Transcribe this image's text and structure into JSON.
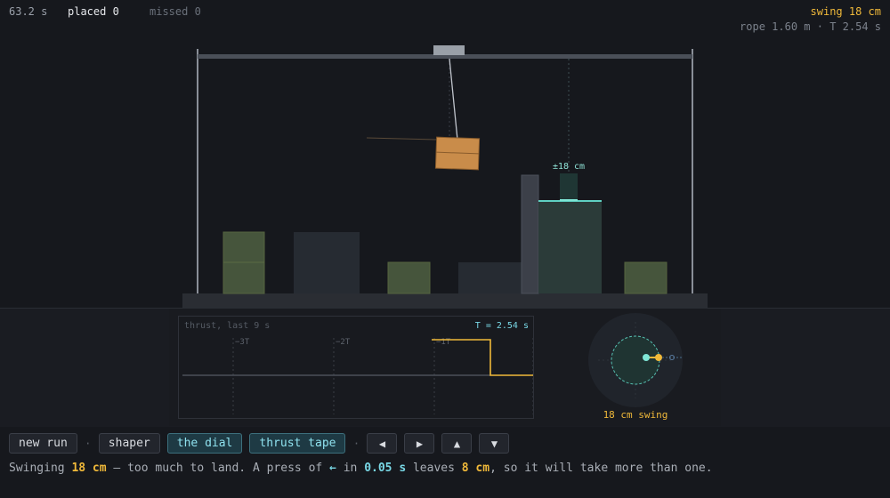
{
  "hud": {
    "time": "63.2 s",
    "placed": "placed 0",
    "missed": "missed 0",
    "swing": "swing 18 cm",
    "rope": "rope 1.60 m · T 2.54 s"
  },
  "scene": {
    "target_label": "±18 cm"
  },
  "tape": {
    "title": "thrust, last 9 s",
    "period": "T = 2.54 s",
    "markers": [
      "−3T",
      "−2T",
      "−1T"
    ]
  },
  "dial": {
    "caption": "18 cm swing"
  },
  "controls": {
    "new_run": "new run",
    "shaper": "shaper",
    "the_dial": "the dial",
    "thrust_tape": "thrust tape",
    "separator": "·",
    "left": "◀",
    "right": "▶",
    "up": "▲",
    "down": "▼"
  },
  "message": {
    "p1": "Swinging ",
    "swing": "18 cm",
    "p2": " — too much to land. A press of ",
    "key": "←",
    "p3": " in ",
    "time": "0.05 s",
    "p4": " leaves ",
    "residual": "8 cm",
    "p5": ", so it will take more than one."
  },
  "colors": {
    "accent_yellow": "#f0b93a",
    "accent_cyan": "#79d8e6",
    "crate": "#c98c4a"
  }
}
